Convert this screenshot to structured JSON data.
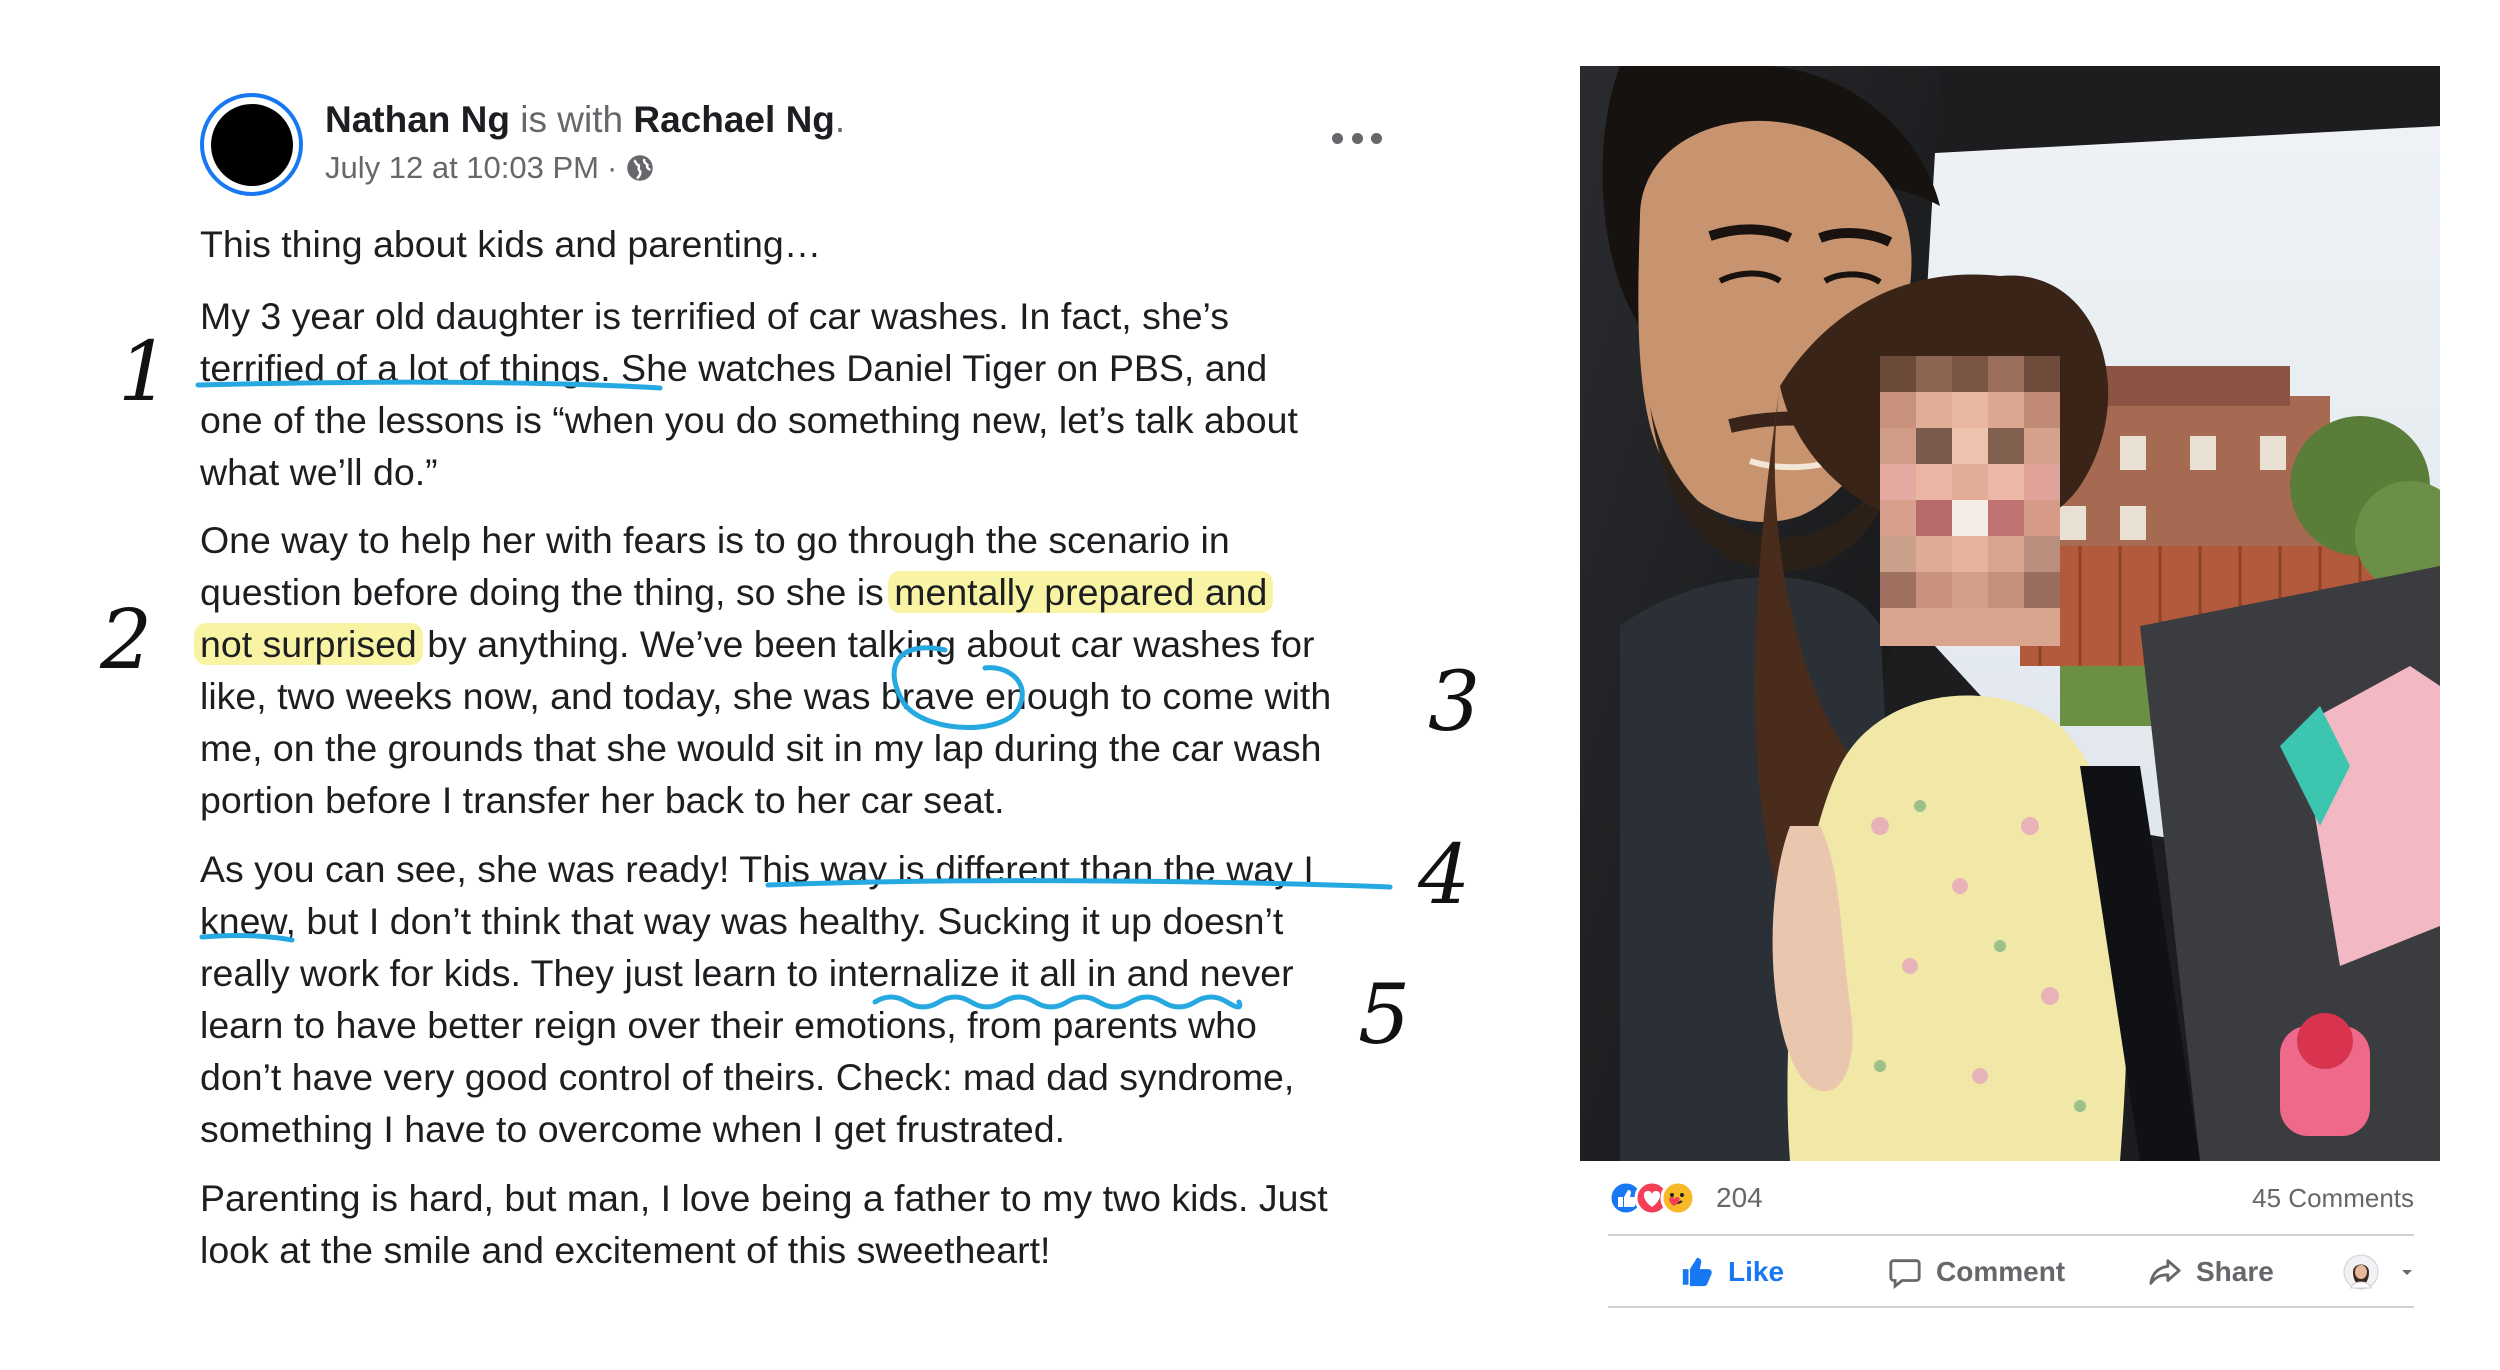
{
  "post": {
    "author": "Nathan Ng",
    "with_text": "is with",
    "tagged": "Rachael Ng",
    "period": ".",
    "timestamp": "July 12 at 10:03 PM",
    "separator": "·",
    "privacy_icon": "globe-icon",
    "more_icon": "more-options-icon",
    "paragraphs": {
      "p1": "This thing about kids and parenting…",
      "p2_a": "My 3 year old daughter is terrified of car washes. In fact, she’s\n",
      "p2_b": "terrified of a lot of things.",
      "p2_c": " She watches Daniel Tiger on PBS, and\none of the lessons is “when you do something new, let’s talk about\nwhat we’ll do.”",
      "p3_a": "One way to help her with fears is to go through the scenario in\nquestion before doing the thing, so she is ",
      "p3_hl1": "mentally prepared and",
      "p3_nl": "\n",
      "p3_hl2": "not surprised",
      "p3_c": " by anything. We’ve been talking about car washes for\nlike, two weeks now, and today, she was ",
      "p3_d": "brave",
      "p3_e": " enough to come with\nme, on the grounds that she would sit in my lap during the car wash\nportion before I transfer her back to her car seat.",
      "p4_a": "As you can see, she was ready! ",
      "p4_b": "This way is different than the way I\nknew",
      "p4_c": ", but I don’t think that way was healthy. Sucking it up doesn’t\nreally work for kids. They just learn to ",
      "p4_d": "internalize it all",
      "p4_e": " in and never\nlearn to have better reign over their emotions, from parents who\ndon’t have very good control of theirs. Check: mad dad syndrome,\nsomething I have to overcome when I get frustrated.",
      "p5": "Parenting is hard, but man, I love being a father to my two kids. Just\nlook at the smile and excitement of this sweetheart!"
    }
  },
  "annotations": {
    "numbers": [
      "1",
      "2",
      "3",
      "4",
      "5"
    ],
    "highlight_color": "#f8f4a4",
    "ink_color": "#26a9e0"
  },
  "stats": {
    "reaction_icons": [
      "like-reaction-icon",
      "love-reaction-icon",
      "care-reaction-icon"
    ],
    "reaction_count": "204",
    "comments": "45 Comments"
  },
  "actions": {
    "like": "Like",
    "comment": "Comment",
    "share": "Share"
  },
  "colors": {
    "facebook_blue": "#1877f2",
    "muted_text": "#65676b",
    "love_red": "#f33e58",
    "care_yellow": "#f7b928"
  }
}
